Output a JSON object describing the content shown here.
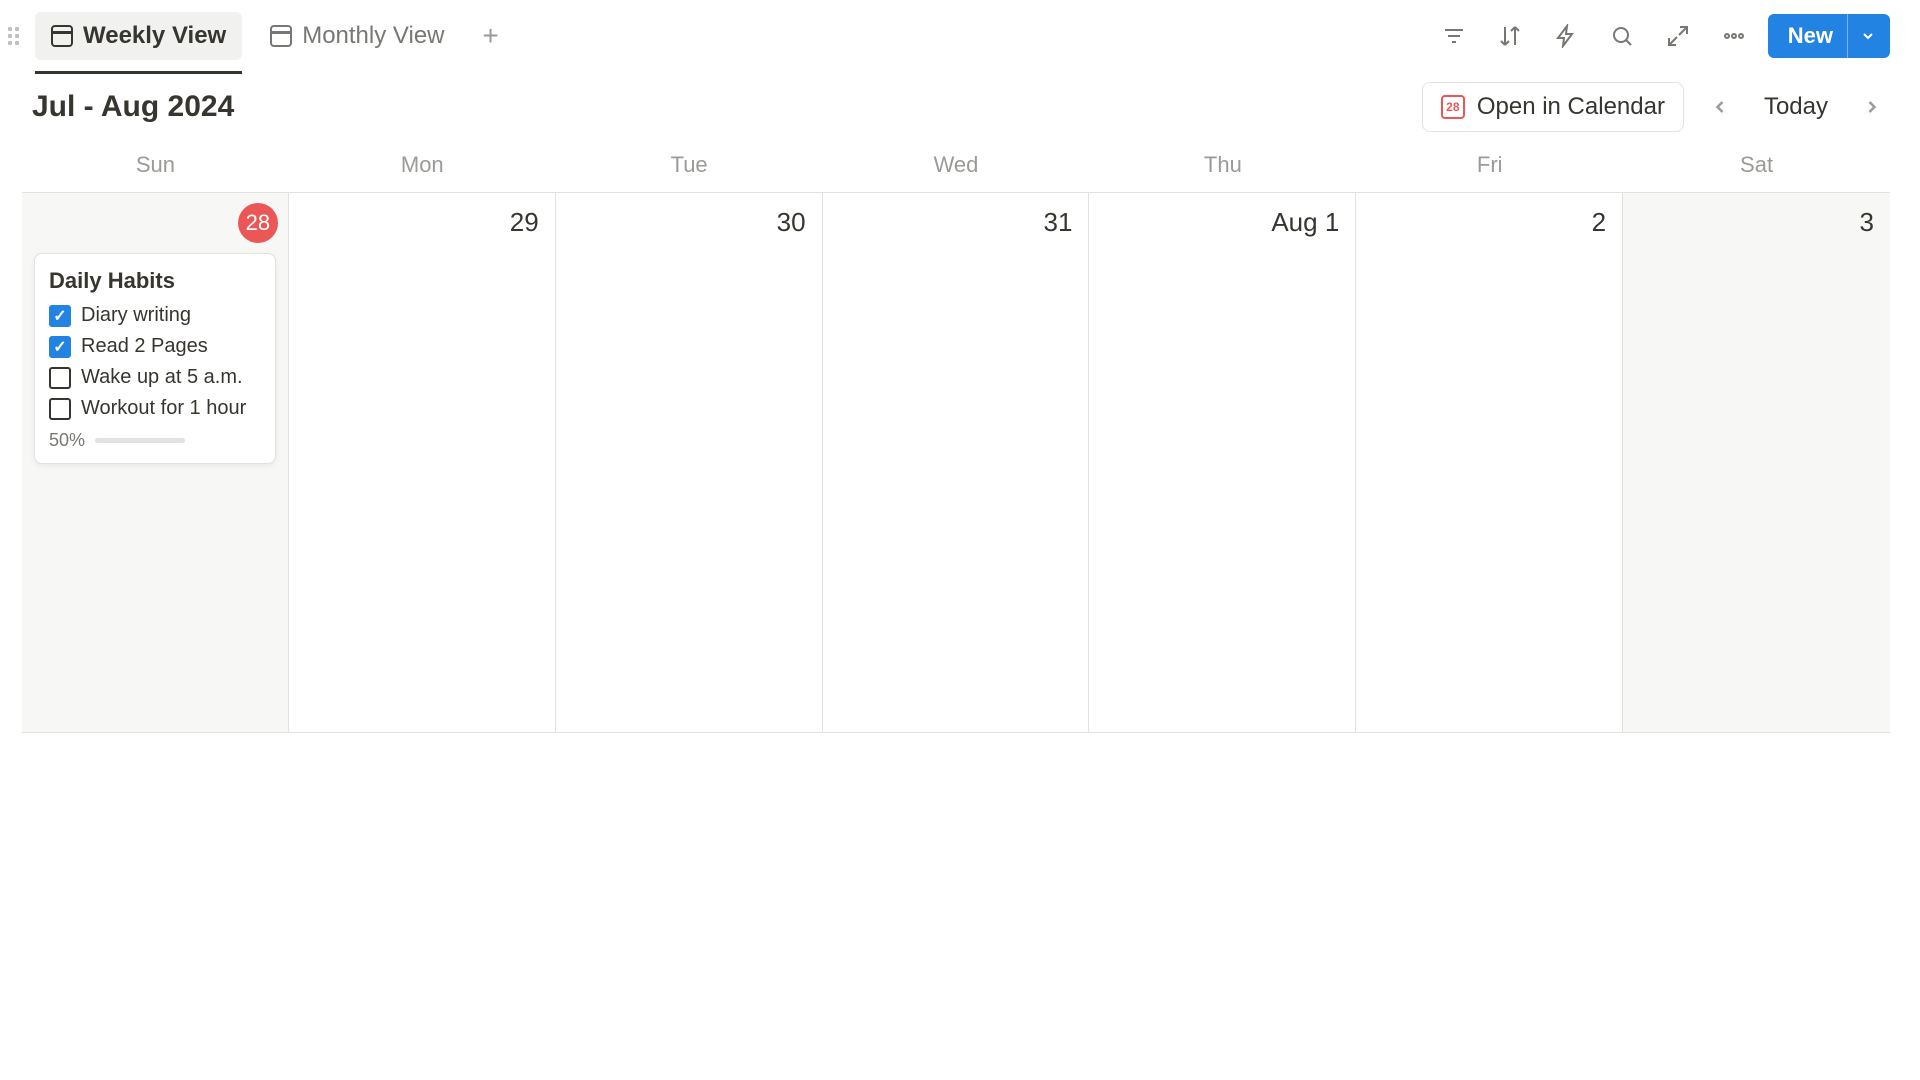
{
  "views": {
    "active": "Weekly View",
    "other": "Monthly View"
  },
  "new_label": "New",
  "title": "Jul - Aug 2024",
  "open_in_calendar": {
    "label": "Open in Calendar",
    "badge": "28"
  },
  "today_label": "Today",
  "dow": [
    "Sun",
    "Mon",
    "Tue",
    "Wed",
    "Thu",
    "Fri",
    "Sat"
  ],
  "days": [
    {
      "label": "28",
      "today": true,
      "weekend": true
    },
    {
      "label": "29",
      "today": false,
      "weekend": false
    },
    {
      "label": "30",
      "today": false,
      "weekend": false
    },
    {
      "label": "31",
      "today": false,
      "weekend": false
    },
    {
      "label": "Aug 1",
      "today": false,
      "weekend": false
    },
    {
      "label": "2",
      "today": false,
      "weekend": false
    },
    {
      "label": "3",
      "today": false,
      "weekend": true
    }
  ],
  "card": {
    "title": "Daily Habits",
    "habits": [
      {
        "label": "Diary writing",
        "done": true
      },
      {
        "label": "Read 2 Pages",
        "done": true
      },
      {
        "label": "Wake up at 5 a.m.",
        "done": false
      },
      {
        "label": "Workout for 1 hour",
        "done": false
      }
    ],
    "progress": {
      "pct_label": "50%",
      "pct": 50
    }
  }
}
